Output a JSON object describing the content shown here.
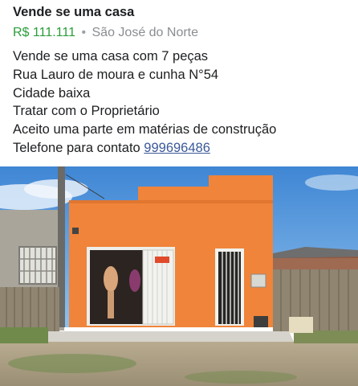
{
  "listing": {
    "title": "Vende se uma casa",
    "price": "R$ 111.111",
    "separator": "•",
    "location": "São José do Norte"
  },
  "description": {
    "lines": [
      "Vende se uma casa com 7 peças",
      "Rua Lauro de moura e cunha N°54",
      "Cidade baixa",
      "Tratar com o Proprietário",
      "Aceito uma parte em matérias de construção"
    ],
    "phone_label": "Telefone para contato",
    "phone_number": "999696486"
  },
  "colors": {
    "price": "#2a9d3a",
    "link": "#3b5998",
    "house_wall": "#f0843a"
  },
  "photo": {
    "subject": "house-photo"
  }
}
